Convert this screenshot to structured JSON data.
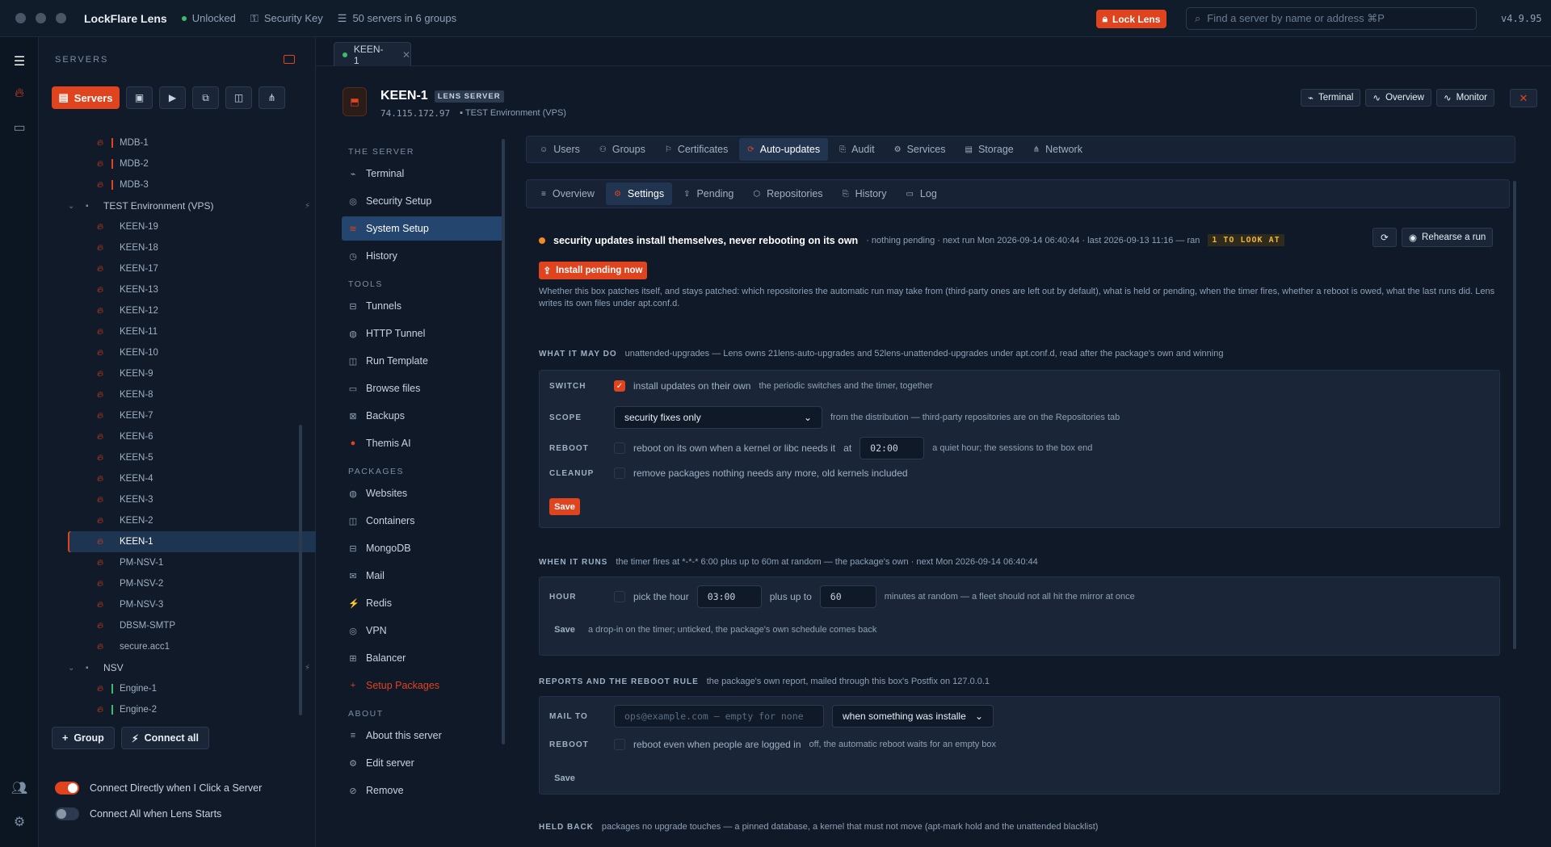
{
  "topbar": {
    "app_title": "LockFlare Lens",
    "status_unlocked": "Unlocked",
    "security_key": "Security Key",
    "servers_count": "50 servers in 6 groups",
    "lock_button": "Lock Lens",
    "search_placeholder": "Find a server by name or address ⌘P",
    "version": "v4.9.95"
  },
  "sidebar": {
    "header": "SERVERS",
    "servers_button": "Servers",
    "tree": [
      {
        "name": "MDB-1",
        "bar": "#e0441f"
      },
      {
        "name": "MDB-2",
        "bar": "#e0441f"
      },
      {
        "name": "MDB-3",
        "bar": "#e0441f"
      },
      {
        "group": "TEST Environment (VPS)"
      },
      {
        "name": "KEEN-19"
      },
      {
        "name": "KEEN-18"
      },
      {
        "name": "KEEN-17"
      },
      {
        "name": "KEEN-13"
      },
      {
        "name": "KEEN-12"
      },
      {
        "name": "KEEN-11"
      },
      {
        "name": "KEEN-10"
      },
      {
        "name": "KEEN-9"
      },
      {
        "name": "KEEN-8"
      },
      {
        "name": "KEEN-7"
      },
      {
        "name": "KEEN-6"
      },
      {
        "name": "KEEN-5"
      },
      {
        "name": "KEEN-4"
      },
      {
        "name": "KEEN-3"
      },
      {
        "name": "KEEN-2"
      },
      {
        "name": "KEEN-1",
        "selected": true
      },
      {
        "name": "PM-NSV-1"
      },
      {
        "name": "PM-NSV-2"
      },
      {
        "name": "PM-NSV-3"
      },
      {
        "name": "DBSM-SMTP"
      },
      {
        "name": "secure.acc1"
      },
      {
        "group": "NSV"
      },
      {
        "name": "Engine-1",
        "bar": "#3dbb6a"
      },
      {
        "name": "Engine-2",
        "bar": "#3dbb6a"
      }
    ],
    "group_button": "Group",
    "connect_all_button": "Connect all",
    "toggle_connect_direct": "Connect Directly when I Click a Server",
    "toggle_connect_all": "Connect All when Lens Starts"
  },
  "tabbar": {
    "tab": "KEEN-1"
  },
  "server": {
    "name": "KEEN-1",
    "badge": "LENS SERVER",
    "address": "74.115.172.97",
    "group": "TEST Environment (VPS)",
    "btn_terminal": "Terminal",
    "btn_overview": "Overview",
    "btn_monitor": "Monitor"
  },
  "subnav": {
    "head_server": "THE SERVER",
    "server_items": [
      "Terminal",
      "Security Setup",
      "System Setup",
      "History"
    ],
    "head_tools": "TOOLS",
    "tool_items": [
      "Tunnels",
      "HTTP Tunnel",
      "Run Template",
      "Browse files",
      "Backups",
      "Themis AI"
    ],
    "head_packages": "PACKAGES",
    "package_items": [
      "Websites",
      "Containers",
      "MongoDB",
      "Mail",
      "Redis",
      "VPN",
      "Balancer",
      "Setup Packages"
    ],
    "head_about": "ABOUT",
    "about_items": [
      "About this server",
      "Edit server",
      "Remove"
    ]
  },
  "tabs1": [
    "Users",
    "Groups",
    "Certificates",
    "Auto-updates",
    "Audit",
    "Services",
    "Storage",
    "Network"
  ],
  "tabs2": [
    "Overview",
    "Settings",
    "Pending",
    "Repositories",
    "History",
    "Log"
  ],
  "status": {
    "title": "security updates install themselves, never rebooting on its own",
    "meta": "· nothing pending · next run Mon 2026-09-14 06:40:44 · last 2026-09-13 11:16 — ran",
    "look": "1 TO LOOK AT",
    "rehearse": "Rehearse a run",
    "install_button": "Install pending now",
    "description": "Whether this box patches itself, and stays patched: which repositories the automatic run may take from (third-party ones are left out by default), what is held or pending, when the timer fires, whether a reboot is owed, what the last runs did. Lens writes its own files under apt.conf.d."
  },
  "what": {
    "label": "WHAT IT MAY DO",
    "desc": "unattended-upgrades — Lens owns 21lens-auto-upgrades and 52lens-unattended-upgrades under apt.conf.d, read after the package's own and winning",
    "switch_label": "SWITCH",
    "switch_text": "install updates on their own",
    "switch_hint": "the periodic switches and the timer, together",
    "scope_label": "SCOPE",
    "scope_value": "security fixes only",
    "scope_hint": "from the distribution — third-party repositories are on the Repositories tab",
    "reboot_label": "REBOOT",
    "reboot_text": "reboot on its own when a kernel or libc needs it",
    "reboot_at": "at",
    "reboot_time": "02:00",
    "reboot_hint": "a quiet hour; the sessions to the box end",
    "cleanup_label": "CLEANUP",
    "cleanup_text": "remove packages nothing needs any more, old kernels included",
    "save": "Save"
  },
  "when": {
    "label": "WHEN IT RUNS",
    "desc": "the timer fires at *-*-* 6:00 plus up to 60m at random — the package's own · next Mon 2026-09-14 06:40:44",
    "hour_label": "HOUR",
    "hour_text": "pick the hour",
    "hour_value": "03:00",
    "plus_text": "plus up to",
    "plus_value": "60",
    "hour_hint": "minutes at random — a fleet should not all hit the mirror at once",
    "save": "Save",
    "save_hint": "a drop-in on the timer; unticked, the package's own schedule comes back"
  },
  "reports": {
    "label": "REPORTS AND THE REBOOT RULE",
    "desc": "the package's own report, mailed through this box's Postfix on 127.0.0.1",
    "mail_label": "MAIL TO",
    "mail_placeholder": "ops@example.com — empty for none",
    "mail_when": "when something was installe",
    "reboot_label": "REBOOT",
    "reboot_text": "reboot even when people are logged in",
    "reboot_hint": "off, the automatic reboot waits for an empty box",
    "save": "Save"
  },
  "held": {
    "label": "HELD BACK",
    "desc": "packages no upgrade touches — a pinned database, a kernel that must not move (apt-mark hold and the unattended blacklist)"
  }
}
